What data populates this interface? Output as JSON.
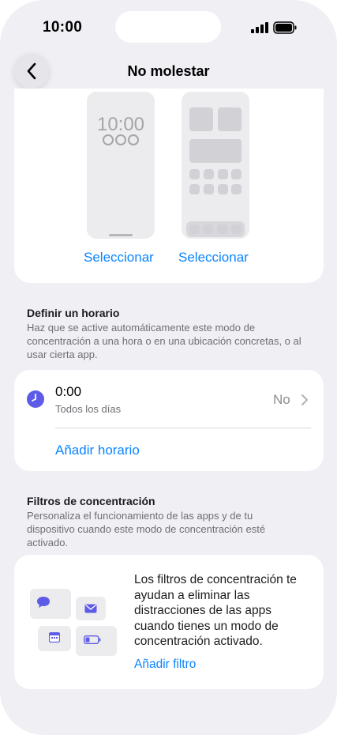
{
  "status_bar": {
    "time": "10:00"
  },
  "nav": {
    "title": "No molestar"
  },
  "screens": {
    "lock_time": "10:00",
    "select_lock_label": "Seleccionar",
    "select_home_label": "Seleccionar"
  },
  "schedule_section": {
    "title": "Definir un horario",
    "description": "Haz que se active automáticamente este modo de concentración a una hora o en una ubicación concretas, o al usar cierta app."
  },
  "schedule": {
    "time": "0:00",
    "days": "Todos los días",
    "status": "No",
    "add_label": "Añadir horario"
  },
  "filters_section": {
    "title": "Filtros de concentración",
    "description": "Personaliza el funcionamiento de las apps y de tu dispositivo cuando este modo de concentración esté activado."
  },
  "filters_card": {
    "text": "Los filtros de concentración te ayudan a eliminar las distracciones de las apps cuando tienes un modo de concentración activado.",
    "add_label": "Añadir filtro"
  },
  "colors": {
    "accent": "#0a84ff",
    "clock": "#5e5ce6"
  }
}
